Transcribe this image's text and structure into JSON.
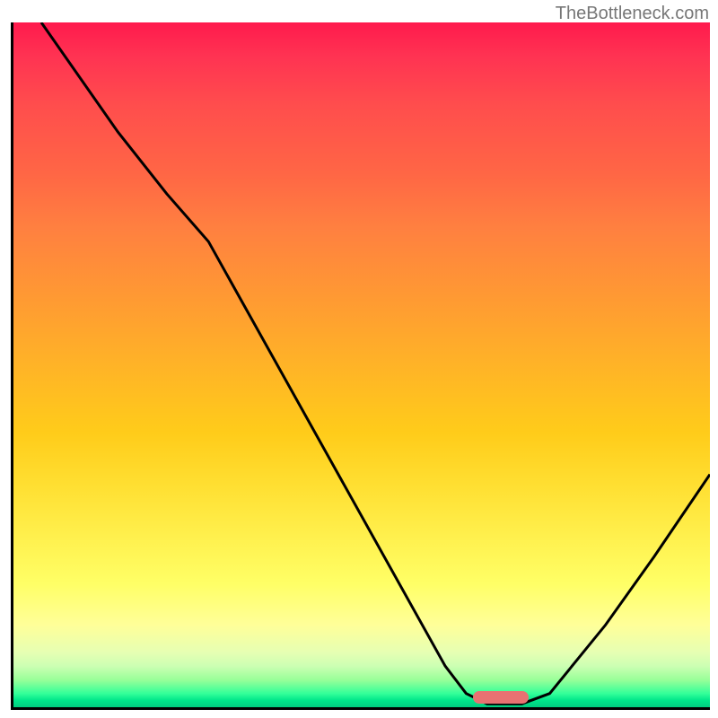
{
  "watermark": "TheBottleneck.com",
  "chart_data": {
    "type": "line",
    "title": "",
    "xlabel": "",
    "ylabel": "",
    "ylim": [
      0,
      100
    ],
    "xlim": [
      0,
      100
    ],
    "curve_points": [
      {
        "x": 4.0,
        "y": 100
      },
      {
        "x": 15,
        "y": 84
      },
      {
        "x": 22,
        "y": 75
      },
      {
        "x": 28,
        "y": 68
      },
      {
        "x": 62,
        "y": 6
      },
      {
        "x": 65,
        "y": 2
      },
      {
        "x": 68,
        "y": 0.5
      },
      {
        "x": 73,
        "y": 0.5
      },
      {
        "x": 77,
        "y": 2
      },
      {
        "x": 85,
        "y": 12
      },
      {
        "x": 92,
        "y": 22
      },
      {
        "x": 100,
        "y": 34
      }
    ],
    "optimal_marker": {
      "x_start": 66,
      "x_end": 74,
      "y": 1.5
    },
    "gradient_meaning": "bottleneck severity (red=high, green=optimal)"
  }
}
